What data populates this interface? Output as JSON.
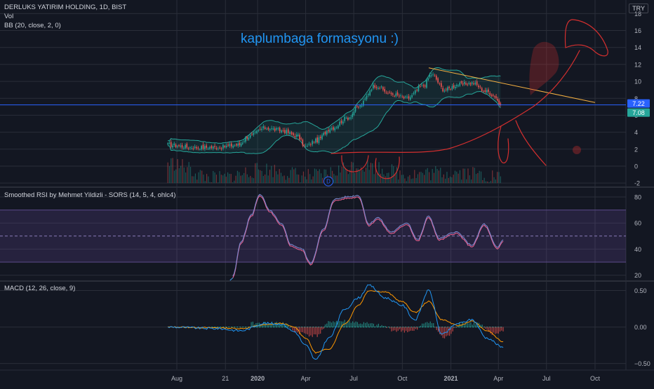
{
  "header": {
    "symbol_line": "DERLUKS YATIRIM HOLDING, 1D, BIST",
    "vol_label": "Vol",
    "bb_label": "BB (20, close, 2, 0)",
    "currency": "TRY"
  },
  "annotation": {
    "text": "kaplumbaga formasyonu :)"
  },
  "colors": {
    "background": "#131722",
    "grid": "#2a2e39",
    "up": "#26a69a",
    "down": "#ef5350",
    "bb": "#26a69a",
    "horizontal_line": "#2962ff",
    "trendline": "#f5b041",
    "drawing": "#d32f2f",
    "rsi_band": "#7e57c2",
    "rsi_line": "#7e57c2",
    "macd_line": "#2196f3",
    "signal_line": "#ff9800"
  },
  "time_axis": {
    "labels": [
      "Aug",
      "21",
      "2020",
      "Apr",
      "Jul",
      "Oct",
      "2021",
      "Apr",
      "Jul",
      "Oct"
    ],
    "bold": [
      "2020",
      "2021"
    ]
  },
  "chart_data": [
    {
      "type": "candlestick",
      "title": "DERLUKS YATIRIM HOLDING, 1D, BIST",
      "ylim": [
        -2.4,
        19.6
      ],
      "y_ticks": [
        -2,
        0,
        2,
        4,
        6,
        8,
        10,
        12,
        14,
        16,
        18
      ],
      "price_labels": [
        {
          "value": "7.22",
          "color": "#2962ff"
        },
        {
          "value": "7.08",
          "color": "#26a69a"
        }
      ],
      "horizontal_line": 7.22,
      "trendline": [
        [
          "2020-11-20",
          11.6
        ],
        [
          "2021-10-01",
          7.5
        ]
      ],
      "marker": "D",
      "series": [
        {
          "name": "Price (close, approx.)",
          "x": [
            "2019-07-15",
            "2019-09-01",
            "2019-10-15",
            "2019-11-25",
            "2019-12-15",
            "2020-01-15",
            "2020-02-15",
            "2020-03-15",
            "2020-04-01",
            "2020-04-20",
            "2020-05-20",
            "2020-06-20",
            "2020-07-10",
            "2020-08-10",
            "2020-09-10",
            "2020-10-10",
            "2020-11-10",
            "2020-11-25",
            "2020-12-20",
            "2021-01-15",
            "2021-02-10",
            "2021-03-10",
            "2021-03-25",
            "2021-04-05"
          ],
          "values": [
            2.5,
            2.2,
            2.2,
            2.5,
            3.5,
            4.5,
            4.2,
            3.6,
            2.3,
            3.0,
            4.5,
            5.7,
            7.0,
            9.5,
            8.5,
            8.0,
            9.5,
            10.8,
            9.0,
            9.6,
            9.8,
            8.8,
            8.3,
            7.2
          ]
        },
        {
          "name": "Vol",
          "x": [
            "2019-07-15",
            "2019-10-15",
            "2020-01-15",
            "2020-04-15",
            "2020-07-15",
            "2020-10-15",
            "2021-01-15",
            "2021-04-05"
          ],
          "values": [
            0.9,
            0.2,
            0.6,
            0.3,
            0.8,
            0.4,
            0.5,
            0.3
          ]
        }
      ]
    },
    {
      "type": "line",
      "title": "Smoothed RSI by Mehmet Yildizli - SORS (14, 5, 4, ohlc4)",
      "ylim": [
        16,
        87
      ],
      "y_ticks": [
        20,
        40,
        60,
        80
      ],
      "band": [
        30,
        70
      ],
      "midline": 50,
      "series": [
        {
          "name": "SORS",
          "x": [
            "2019-11-15",
            "2019-12-01",
            "2019-12-20",
            "2020-01-05",
            "2020-01-25",
            "2020-02-15",
            "2020-03-05",
            "2020-03-25",
            "2020-04-10",
            "2020-05-05",
            "2020-05-25",
            "2020-06-20",
            "2020-07-10",
            "2020-07-30",
            "2020-08-15",
            "2020-09-10",
            "2020-10-10",
            "2020-10-30",
            "2020-11-20",
            "2020-12-10",
            "2021-01-10",
            "2021-02-10",
            "2021-03-05",
            "2021-03-30",
            "2021-04-10"
          ],
          "values": [
            18,
            45,
            65,
            81,
            68,
            58,
            42,
            39,
            28,
            54,
            77,
            79,
            80,
            58,
            63,
            52,
            59,
            46,
            64,
            47,
            52,
            42,
            58,
            40,
            46
          ]
        }
      ]
    },
    {
      "type": "line",
      "title": "MACD (12, 26, close, 9)",
      "ylim": [
        -0.58,
        0.62
      ],
      "y_ticks": [
        -0.5,
        0.0,
        0.5
      ],
      "y_tick_labels": [
        "−0.50",
        "0.00",
        "0.50"
      ],
      "series": [
        {
          "name": "MACD",
          "x": [
            "2019-07-15",
            "2019-10-15",
            "2019-11-30",
            "2020-01-15",
            "2020-02-15",
            "2020-03-10",
            "2020-04-01",
            "2020-04-20",
            "2020-05-15",
            "2020-06-15",
            "2020-07-10",
            "2020-07-30",
            "2020-08-30",
            "2020-09-30",
            "2020-10-25",
            "2020-11-20",
            "2020-12-15",
            "2021-01-15",
            "2021-02-10",
            "2021-03-10",
            "2021-04-10"
          ],
          "values": [
            0.0,
            -0.02,
            -0.05,
            0.05,
            0.04,
            -0.06,
            -0.25,
            -0.45,
            -0.15,
            0.25,
            0.4,
            0.57,
            0.4,
            0.3,
            0.1,
            0.5,
            -0.1,
            0.05,
            0.1,
            -0.15,
            -0.28
          ]
        },
        {
          "name": "Signal",
          "x": [
            "2019-07-15",
            "2019-10-15",
            "2019-11-30",
            "2020-01-15",
            "2020-02-15",
            "2020-03-10",
            "2020-04-01",
            "2020-04-20",
            "2020-05-15",
            "2020-06-15",
            "2020-07-10",
            "2020-07-30",
            "2020-08-30",
            "2020-09-30",
            "2020-10-25",
            "2020-11-20",
            "2020-12-15",
            "2021-01-15",
            "2021-02-10",
            "2021-03-10",
            "2021-04-10"
          ],
          "values": [
            0.0,
            -0.01,
            -0.02,
            0.03,
            0.05,
            0.0,
            -0.15,
            -0.35,
            -0.3,
            0.05,
            0.3,
            0.5,
            0.48,
            0.35,
            0.2,
            0.35,
            0.1,
            0.02,
            0.08,
            -0.05,
            -0.2
          ]
        },
        {
          "name": "Histogram",
          "x": [
            "2019-12-20",
            "2020-02-15",
            "2020-03-20",
            "2020-04-20",
            "2020-05-20",
            "2020-06-20",
            "2020-07-20",
            "2020-08-20",
            "2020-09-20",
            "2020-10-20",
            "2020-11-20",
            "2020-12-20",
            "2021-01-20",
            "2021-02-20",
            "2021-03-20",
            "2021-04-10"
          ],
          "values": [
            0.05,
            0.06,
            -0.08,
            -0.12,
            0.08,
            0.08,
            0.05,
            0.02,
            -0.05,
            -0.06,
            0.08,
            -0.15,
            0.06,
            0.05,
            -0.1,
            -0.06
          ]
        }
      ]
    }
  ]
}
